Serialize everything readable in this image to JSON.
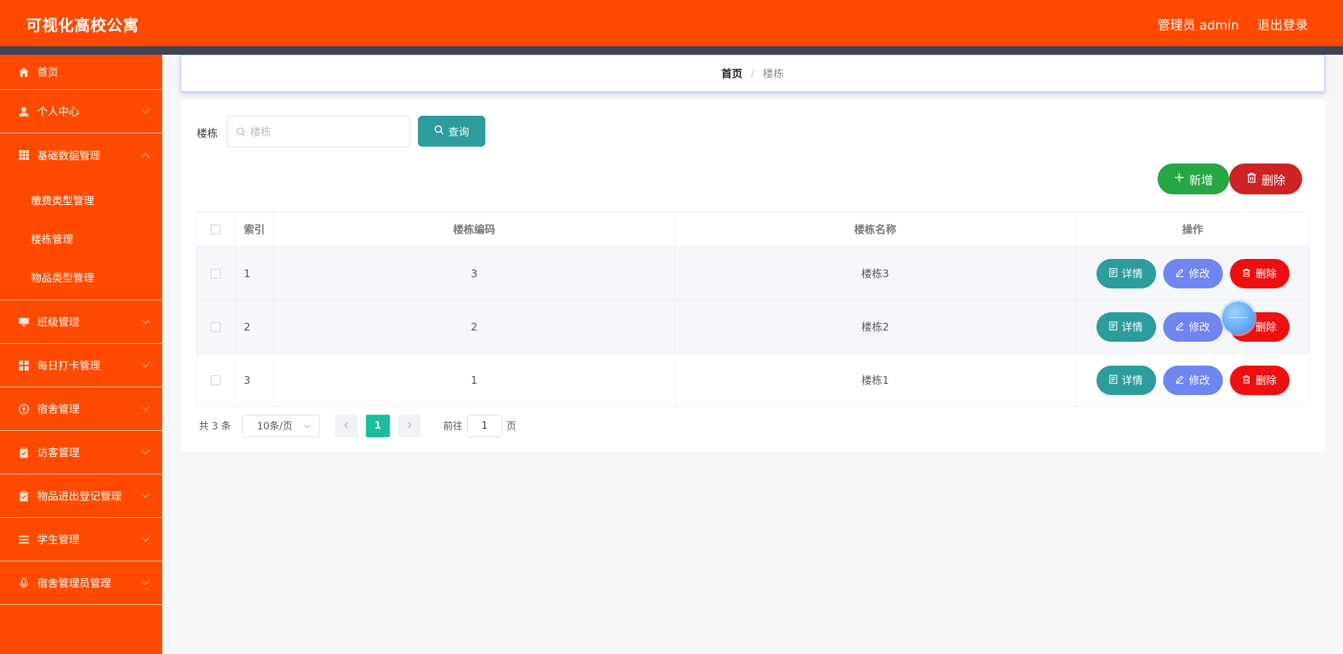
{
  "header": {
    "app_title": "可视化高校公寓",
    "user_label": "管理员 admin",
    "logout_label": "退出登录"
  },
  "sidebar": {
    "items": [
      {
        "label": "首页",
        "icon": "home-icon"
      },
      {
        "label": "个人中心",
        "icon": "user-icon"
      },
      {
        "label": "基础数据管理",
        "icon": "grid-icon"
      },
      {
        "label": "班级管理",
        "icon": "monitor-icon"
      },
      {
        "label": "每日打卡管理",
        "icon": "apps-icon"
      },
      {
        "label": "宿舍管理",
        "icon": "compass-icon"
      },
      {
        "label": "访客管理",
        "icon": "clipboard-icon"
      },
      {
        "label": "物品进出登记管理",
        "icon": "clipboard-check-icon"
      },
      {
        "label": "学生管理",
        "icon": "list-icon"
      },
      {
        "label": "宿舍管理员管理",
        "icon": "microphone-icon"
      }
    ],
    "submenu": [
      "缴费类型管理",
      "楼栋管理",
      "物品类型管理"
    ]
  },
  "breadcrumb": {
    "home": "首页",
    "separator": "/",
    "current": "楼栋"
  },
  "search": {
    "label": "楼栋",
    "placeholder": "楼栋",
    "value": "",
    "query_label": "查询"
  },
  "actions": {
    "add_label": "新增",
    "delete_label": "删除"
  },
  "table": {
    "headers": {
      "index": "索引",
      "code": "楼栋编码",
      "name": "楼栋名称",
      "op": "操作"
    },
    "rows": [
      {
        "index": "1",
        "code": "3",
        "name": "楼栋3"
      },
      {
        "index": "2",
        "code": "2",
        "name": "楼栋2"
      },
      {
        "index": "3",
        "code": "1",
        "name": "楼栋1"
      }
    ],
    "row_actions": {
      "detail": "详情",
      "edit": "修改",
      "delete": "删除"
    }
  },
  "pagination": {
    "total_text": "共 3 条",
    "page_size": "10条/页",
    "current_page": "1",
    "goto_prefix": "前往",
    "goto_value": "1",
    "goto_suffix": "页"
  },
  "colors": {
    "header_bg": "#ff4a00",
    "sidebar_bg": "#ff4a00",
    "teal": "#2c9c9c",
    "green": "#26a644",
    "red": "#cc2424",
    "edit_blue": "#6e85f2",
    "delete_red": "#ee1010",
    "page_active": "#19bf9a"
  }
}
